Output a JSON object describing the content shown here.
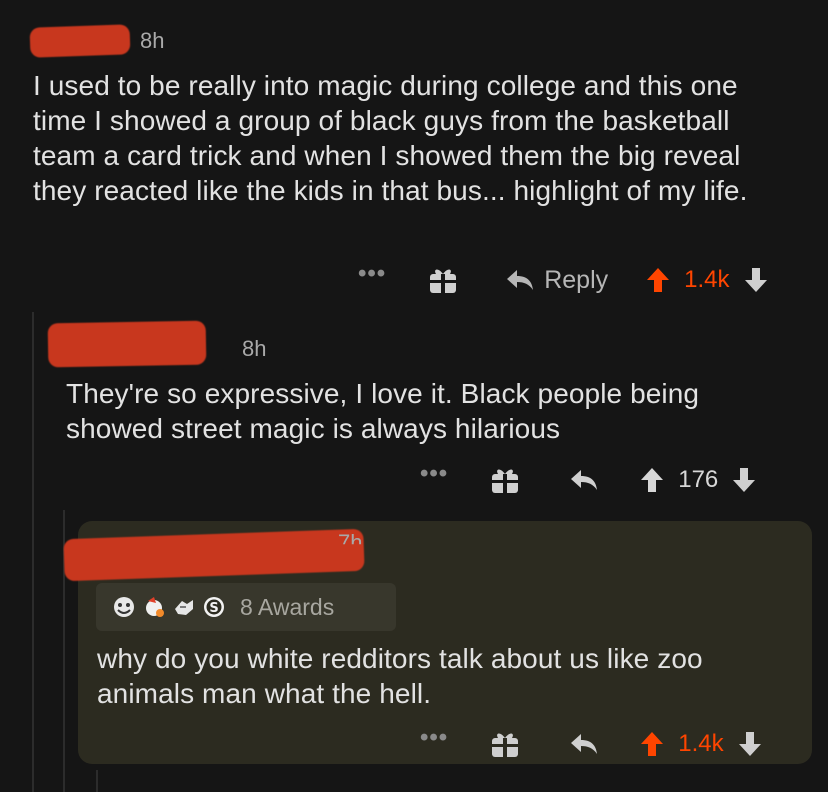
{
  "comments": [
    {
      "time": "8h",
      "text": "I used to be really into magic during college and this one time I showed a group of black guys from the basketball team a card trick and when I showed them the big reveal they reacted like the kids in that bus... highlight of my life.",
      "actions": {
        "more": "•••",
        "reply_label": "Reply",
        "score": "1.4k",
        "score_color": "#ff4500"
      }
    },
    {
      "time": "8h",
      "text": "They're so expressive, I love it. Black people being showed street magic is always hilarious",
      "actions": {
        "more": "•••",
        "score": "176",
        "score_color": "#d7d7d7"
      }
    },
    {
      "time": "7h",
      "awards_label": "8 Awards",
      "text": "why do you white redditors talk about us like zoo animals man what the hell.",
      "actions": {
        "more": "•••",
        "score": "1.4k",
        "score_color": "#ff4500"
      }
    }
  ],
  "colors": {
    "background": "#151515",
    "highlight_card": "#2c2b20",
    "upvote_active": "#ff4500",
    "redaction": "#c8371e"
  },
  "icons": [
    "gift-icon",
    "reply-arrow-icon",
    "upvote-arrow-icon",
    "downvote-arrow-icon",
    "more-options-icon"
  ]
}
